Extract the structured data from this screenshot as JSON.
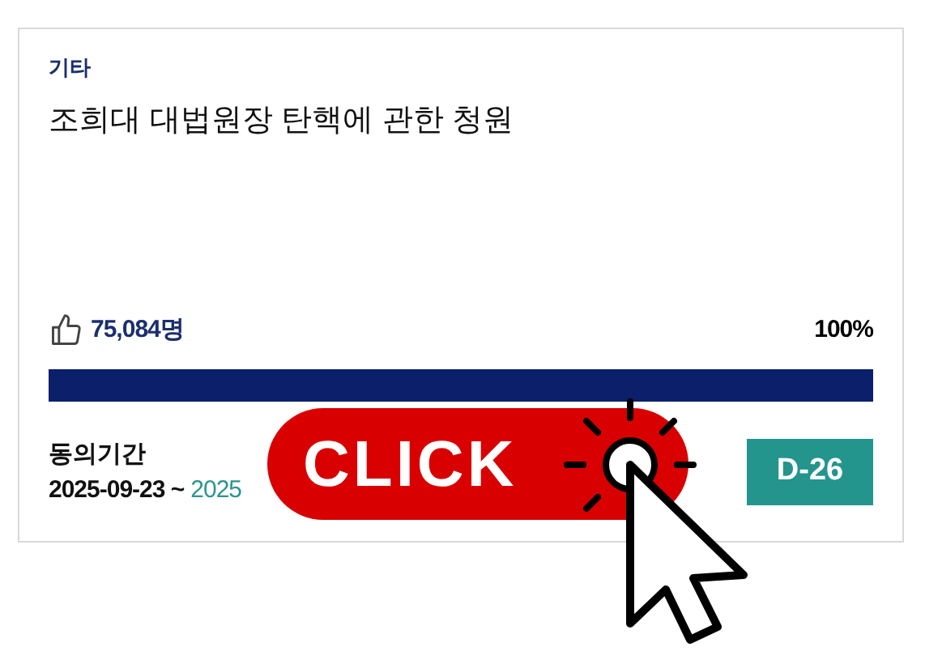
{
  "card": {
    "category": "기타",
    "title": "조희대 대법원장 탄핵에 관한 청원",
    "votes": "75,084명",
    "percent": "100%",
    "progress": {
      "level": 1
    },
    "period_label": "동의기간",
    "period_start": "2025-09-23 ~",
    "period_end": "2025",
    "dday": "D-26"
  },
  "overlay": {
    "label": "CLICK"
  }
}
